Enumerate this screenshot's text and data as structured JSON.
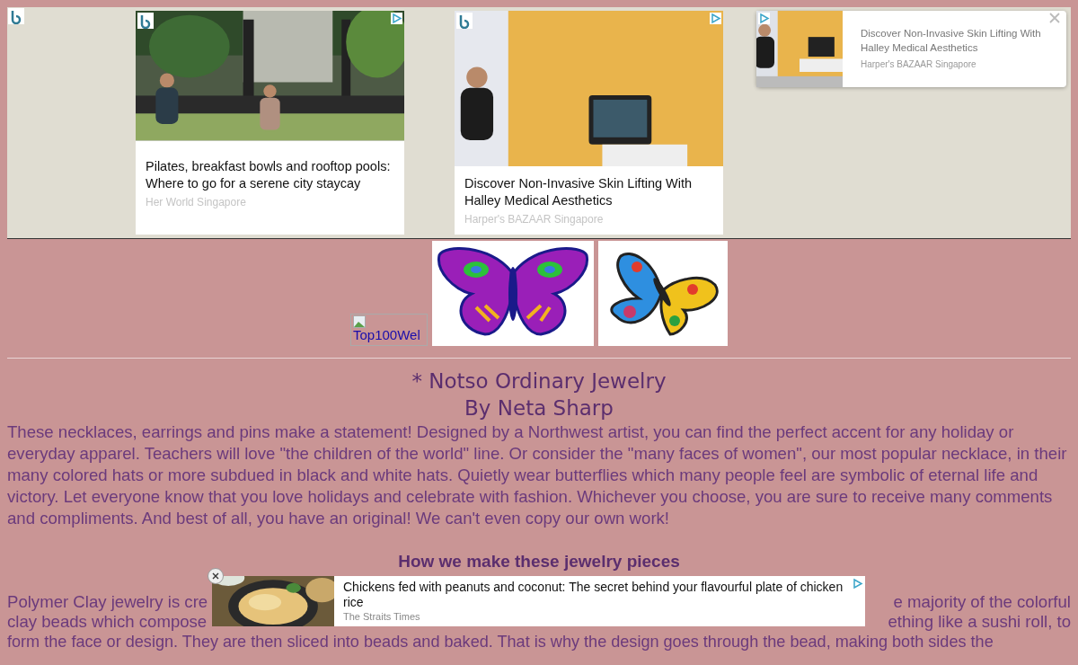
{
  "top_ads": {
    "cards": [
      {
        "title": "Pilates, breakfast bowls and rooftop pools: Where to go for a serene city staycay",
        "source": "Her World Singapore"
      },
      {
        "title": "Discover Non-Invasive Skin Lifting With Halley Medical Aesthetics",
        "source": "Harper's BAZAAR Singapore"
      }
    ],
    "floating": {
      "title": "Discover Non-Invasive Skin Lifting With Halley Medical Aesthetics",
      "source": "Harper's BAZAAR Singapore"
    }
  },
  "broken_image_alt": "Top100Wel",
  "title_lines": [
    "* Notso Ordinary Jewelry",
    "By Neta Sharp"
  ],
  "intro": "These necklaces, earrings and pins make a statement! Designed by a Northwest artist, you can find the perfect accent for any holiday or everyday apparel. Teachers will love \"the children of the world\" line. Or consider the \"many faces of women\", our most popular necklace, in their many colored hats or more subdued in black and white hats. Quietly wear butterflies which many people feel are symbolic of eternal life and victory. Let everyone know that you love holidays and celebrate with fashion. Whichever you choose, you are sure to receive many comments and compliments. And best of all, you have an original! We can't even copy our own work!",
  "heading": "How we make these jewelry pieces",
  "covered_lines": [
    {
      "left": "Polymer Clay jewelry is cre",
      "right": "e majority of the colorful"
    },
    {
      "left": "clay beads which compose",
      "right": "ething like a sushi roll, to"
    }
  ],
  "last_line": "form the face or design. They are then sliced into beads and baked. That is why the design goes through the bead, making both sides the",
  "bottom_ad": {
    "title": "Chickens fed with peanuts and coconut: The secret behind your flavourful plate of chicken rice",
    "source": "The Straits Times"
  }
}
